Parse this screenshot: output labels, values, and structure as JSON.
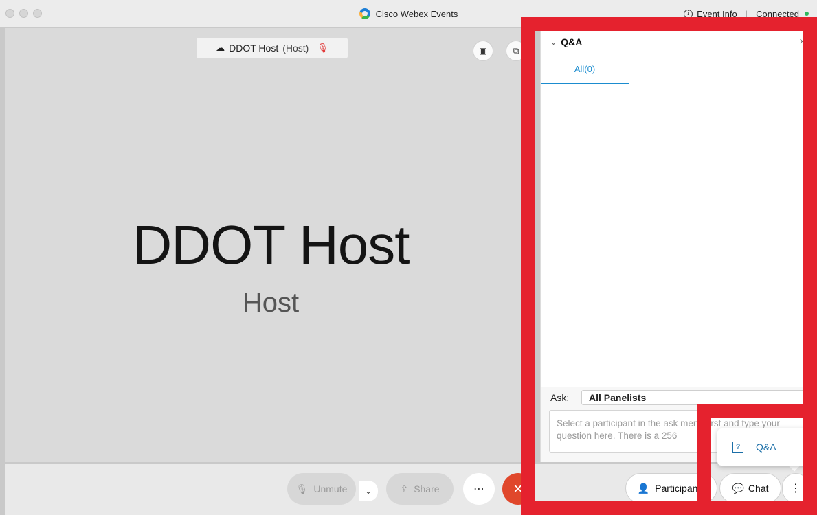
{
  "titlebar": {
    "app_title": "Cisco Webex Events",
    "event_info": "Event Info",
    "separator": "|",
    "status": "Connected",
    "info_glyph": "i"
  },
  "stage": {
    "chip_name": "DDOT Host",
    "chip_role": "(Host)",
    "big_name": "DDOT Host",
    "big_role": "Host",
    "pip_icon": "▣",
    "popout_icon": "⧉",
    "people_icon": "☁",
    "mic_off_icon": "🎙"
  },
  "controls": {
    "unmute": "Unmute",
    "share": "Share",
    "more": "⋯",
    "end": "✕",
    "caret": "⌄"
  },
  "qa": {
    "title": "Q&A",
    "collapse_icon": "⌄",
    "close_icon": "×",
    "tab_all": "All(0)",
    "ask_label": "Ask:",
    "ask_value": "All Panelists",
    "ask_arrows": "⇕",
    "question_placeholder": "Select a participant in the ask menu first and type your question here. There is a 256"
  },
  "bottom_right": {
    "participants": "Participants",
    "chat": "Chat",
    "more": "⋮",
    "participants_icon": "👤",
    "chat_icon": "💬"
  },
  "popup": {
    "qa_label": "Q&A",
    "qa_icon": "?"
  },
  "colors": {
    "accent": "#1b8ccf",
    "annotation_red": "#e5222e",
    "end_call": "#e0472b",
    "connected": "#2eb85c"
  }
}
